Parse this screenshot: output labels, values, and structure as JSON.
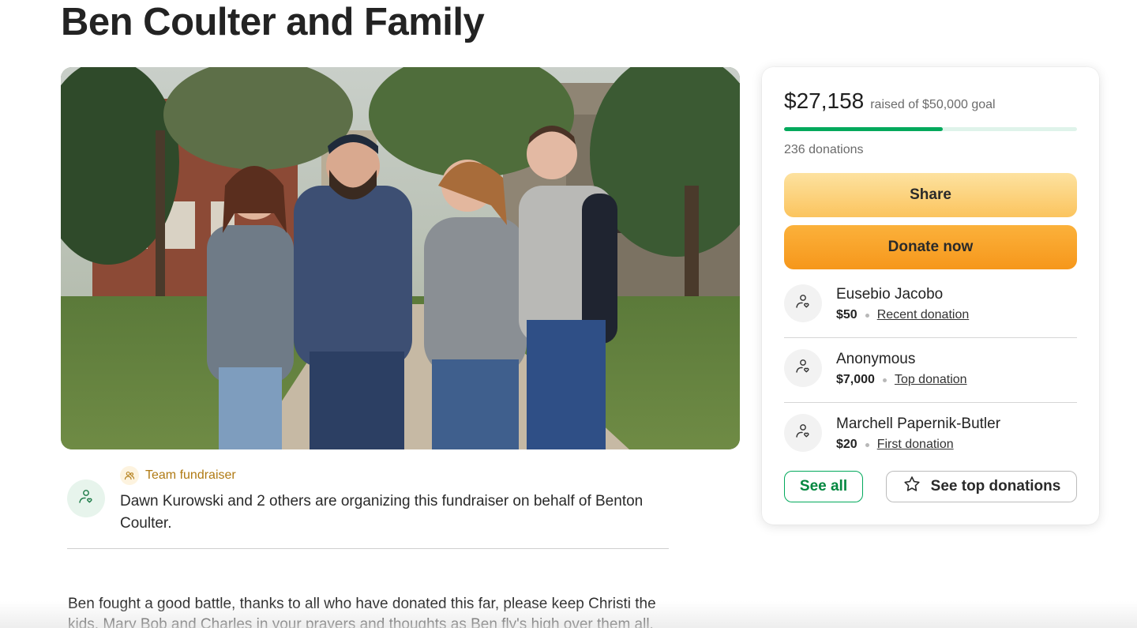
{
  "page": {
    "title": "Ben Coulter and Family"
  },
  "organizer": {
    "team_label": "Team fundraiser",
    "text": "Dawn Kurowski and 2 others are organizing this fundraiser on behalf of Benton Coulter."
  },
  "story": {
    "text": "Ben fought a good battle, thanks to all who have donated this far, please keep Christi the kids, Mary Bob and Charles in your prayers and thoughts as Ben fly's high over them all."
  },
  "donation_card": {
    "amount": "$27,158",
    "goal_text": "raised of $50,000 goal",
    "progress_fraction": 0.543,
    "donation_count": "236 donations",
    "share_label": "Share",
    "donate_label": "Donate now",
    "donors": [
      {
        "name": "Eusebio Jacobo",
        "amount": "$50",
        "label": "Recent donation"
      },
      {
        "name": "Anonymous",
        "amount": "$7,000",
        "label": "Top donation"
      },
      {
        "name": "Marchell Papernik-Butler",
        "amount": "$20",
        "label": "First donation"
      }
    ],
    "see_all_label": "See all",
    "see_top_label": "See top donations"
  },
  "colors": {
    "brand_green": "#02a95c",
    "share_yellow": "#fbc45e",
    "donate_orange": "#f6971b",
    "team_gold": "#b07a13"
  },
  "icons": {
    "donor_avatar": "heart-hand-icon",
    "team": "people-icon",
    "star": "star-outline-icon"
  }
}
